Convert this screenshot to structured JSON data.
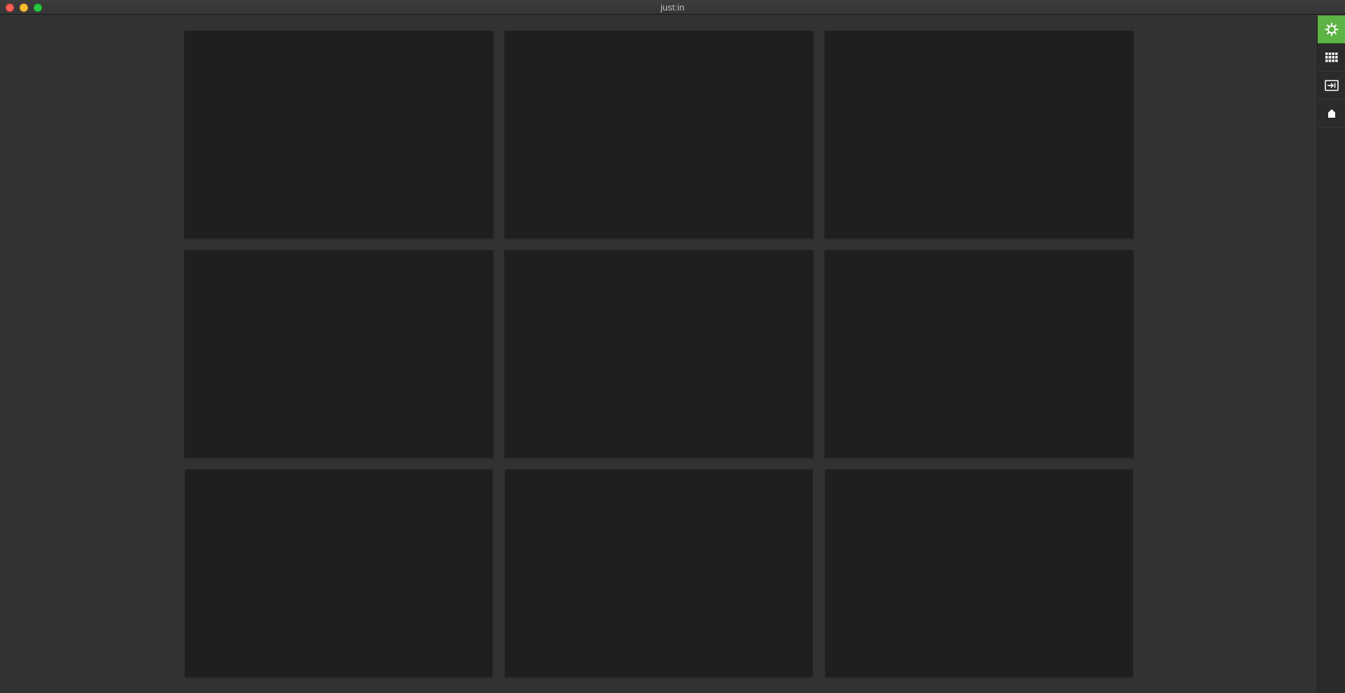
{
  "window": {
    "title": "just:in",
    "traffic_lights": {
      "close_color": "#fe5f57",
      "minimize_color": "#febc2e",
      "maximize_color": "#28c840"
    }
  },
  "grid": {
    "rows": 3,
    "columns": 3,
    "tiles": [
      {
        "row": 1,
        "col": 1
      },
      {
        "row": 1,
        "col": 2
      },
      {
        "row": 1,
        "col": 3
      },
      {
        "row": 2,
        "col": 1
      },
      {
        "row": 2,
        "col": 2
      },
      {
        "row": 2,
        "col": 3
      },
      {
        "row": 3,
        "col": 1
      },
      {
        "row": 3,
        "col": 2
      },
      {
        "row": 3,
        "col": 3
      }
    ]
  },
  "sidebar": {
    "accent_color": "#5db344",
    "buttons": [
      {
        "icon": "gear-icon",
        "active": true
      },
      {
        "icon": "grid-icon",
        "active": false
      },
      {
        "icon": "input-icon",
        "active": false
      },
      {
        "icon": "house-icon",
        "active": false
      }
    ]
  }
}
